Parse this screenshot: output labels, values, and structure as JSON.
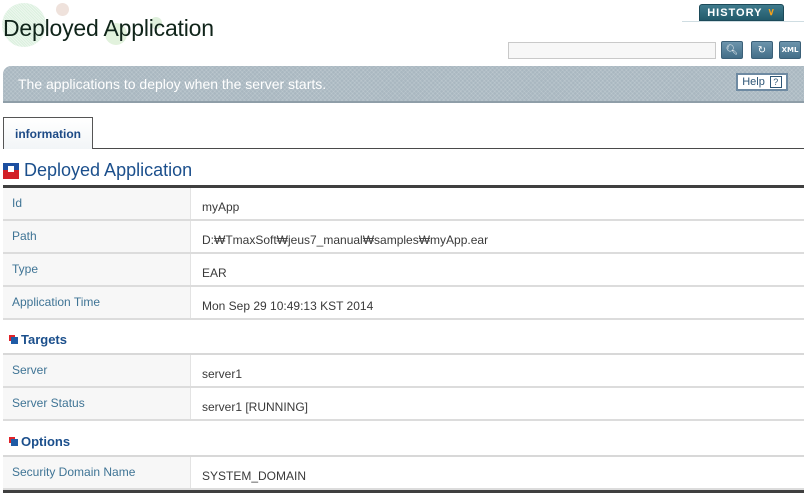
{
  "header": {
    "title": "Deployed Application",
    "history_label": "HISTORY",
    "search": {
      "value": "",
      "placeholder": ""
    },
    "tools": {
      "search_icon": "magnifier-icon",
      "refresh_icon": "refresh-icon",
      "xml_label": "XML"
    }
  },
  "banner": {
    "description": "The applications to deploy when the server starts.",
    "help_label": "Help",
    "help_glyph": "?"
  },
  "tabs": [
    {
      "label": "information",
      "active": true
    }
  ],
  "section": {
    "title": "Deployed Application",
    "rows": [
      {
        "label": "Id",
        "value": "myApp"
      },
      {
        "label": "Path",
        "value": "D:₩TmaxSoft₩jeus7_manual₩samples₩myApp.ear"
      },
      {
        "label": "Type",
        "value": "EAR"
      },
      {
        "label": "Application Time",
        "value": "Mon Sep 29 10:49:13 KST 2014"
      }
    ]
  },
  "targets": {
    "title": "Targets",
    "rows": [
      {
        "label": "Server",
        "value": "server1"
      },
      {
        "label": "Server Status",
        "value": "server1 [RUNNING]"
      }
    ]
  },
  "options": {
    "title": "Options",
    "rows": [
      {
        "label": "Security Domain Name",
        "value": "SYSTEM_DOMAIN"
      }
    ]
  }
}
